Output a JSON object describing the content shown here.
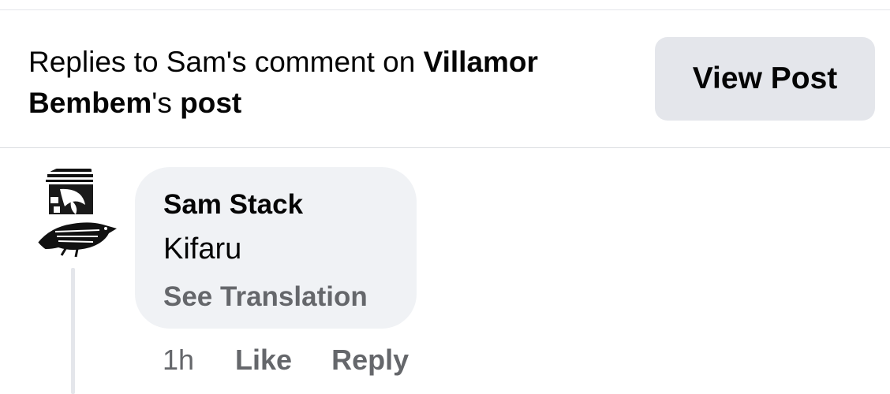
{
  "header": {
    "prefix": "Replies to Sam's comment on ",
    "post_author": "Villamor Bembem",
    "possessive": "'s ",
    "post_word": "post",
    "view_post_label": "View Post"
  },
  "comment": {
    "author": "Sam Stack",
    "text": "Kifaru",
    "see_translation_label": "See Translation",
    "timestamp": "1h",
    "like_label": "Like",
    "reply_label": "Reply",
    "avatar_icon": "bird-profile-icon"
  },
  "colors": {
    "bubble_bg": "#f0f2f5",
    "button_bg": "#e4e6eb",
    "secondary_text": "#65676b",
    "primary_text": "#050505"
  }
}
